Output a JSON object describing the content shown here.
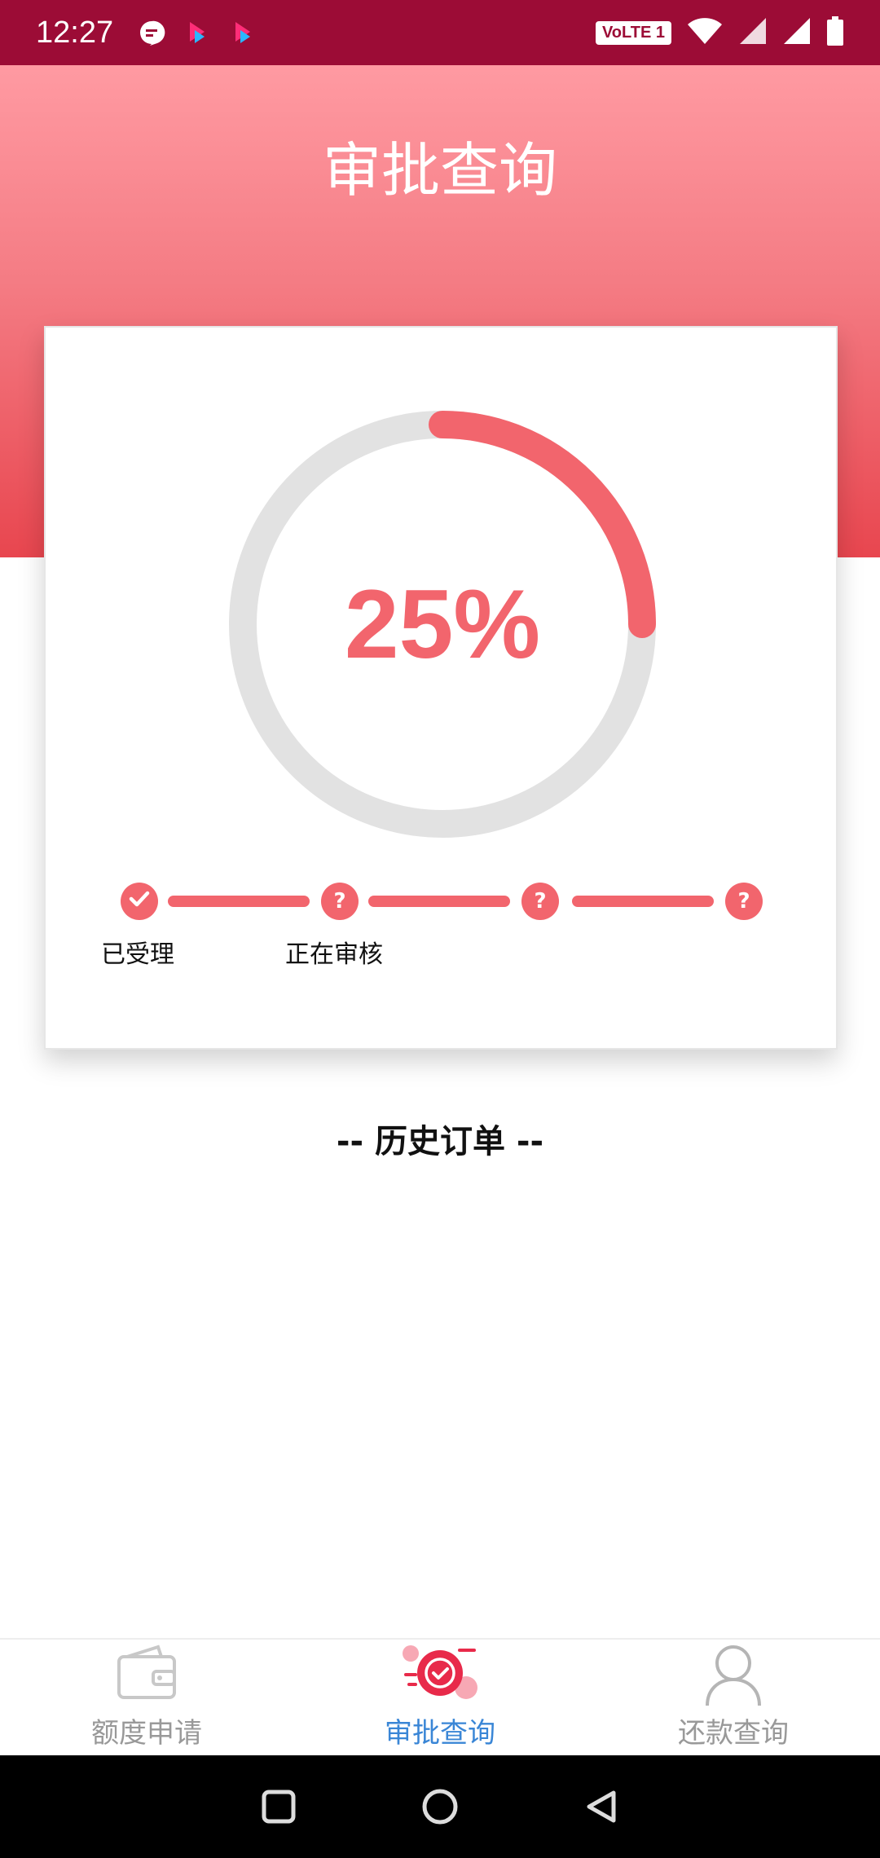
{
  "status_bar": {
    "time": "12:27",
    "volte": "VoLTE 1",
    "icons": [
      "message-icon",
      "app-icon",
      "app-icon",
      "wifi-icon",
      "signal-icon",
      "signal-icon",
      "battery-icon"
    ]
  },
  "header": {
    "title": "审批查询"
  },
  "progress": {
    "percent_text": "25%",
    "value": 0.25,
    "color": "#f2656d",
    "track_color": "#e2e2e2"
  },
  "steps": [
    {
      "status": "done",
      "label": "已受理",
      "icon": "check-icon"
    },
    {
      "status": "pending",
      "label": "正在审核",
      "icon": "question-icon",
      "glyph": "?"
    },
    {
      "status": "pending",
      "label": "",
      "icon": "question-icon",
      "glyph": "?"
    },
    {
      "status": "pending",
      "label": "",
      "icon": "question-icon",
      "glyph": "?"
    }
  ],
  "history": {
    "title": "-- 历史订单 --"
  },
  "tabs": [
    {
      "label": "额度申请",
      "icon": "wallet-icon",
      "active": false
    },
    {
      "label": "审批查询",
      "icon": "approval-check-icon",
      "active": true
    },
    {
      "label": "还款查询",
      "icon": "user-icon",
      "active": false
    }
  ],
  "colors": {
    "status_bar": "#9c0c36",
    "accent": "#f2656d",
    "active_tab": "#3a86d6",
    "inactive_tab": "#999999"
  }
}
